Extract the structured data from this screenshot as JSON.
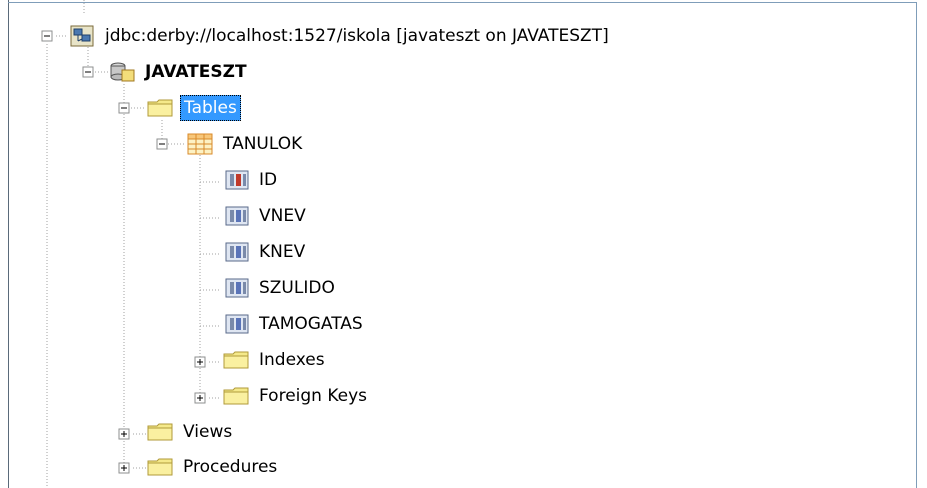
{
  "tree": {
    "connection": {
      "label": "jdbc:derby://localhost:1527/iskola [javateszt on JAVATESZT]"
    },
    "schema": {
      "label": "JAVATESZT"
    },
    "tables_folder": {
      "label": "Tables"
    },
    "table": {
      "label": "TANULOK"
    },
    "columns": [
      {
        "label": "ID",
        "kind": "primary-key"
      },
      {
        "label": "VNEV",
        "kind": "column"
      },
      {
        "label": "KNEV",
        "kind": "column"
      },
      {
        "label": "SZULIDO",
        "kind": "column"
      },
      {
        "label": "TAMOGATAS",
        "kind": "column"
      }
    ],
    "indexes": {
      "label": "Indexes"
    },
    "foreign_keys": {
      "label": "Foreign Keys"
    },
    "views": {
      "label": "Views"
    },
    "procedures": {
      "label": "Procedures"
    }
  },
  "colors": {
    "selection": "#3399ff",
    "folder": "#f5e98a",
    "column_icon": "#5a74b8",
    "pk_icon": "#c0392b"
  }
}
